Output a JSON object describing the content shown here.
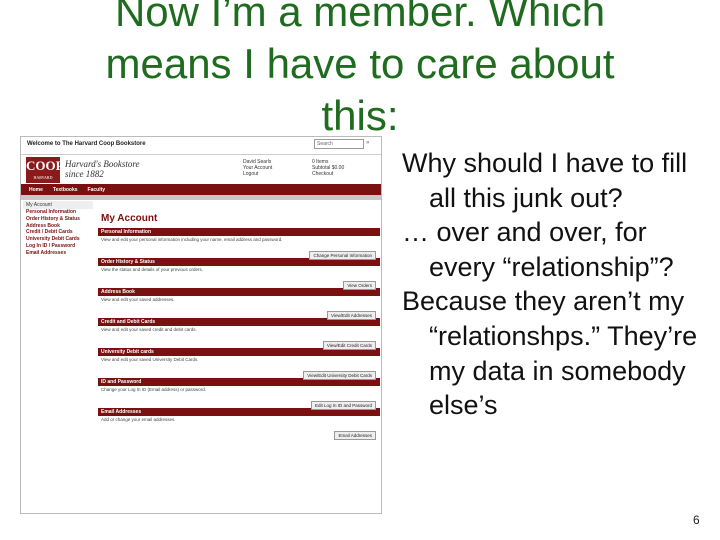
{
  "title": {
    "line1": "Now I’m a member. Which",
    "line2": "means I have to care about",
    "line3": "this:"
  },
  "bullets": [
    "Why should I have to fill all this junk out?",
    "… over and over, for every “relationship”?",
    "Because they aren’t my “relationshps.” They’re my data in somebody else’s"
  ],
  "page_number": "6",
  "screenshot": {
    "welcome": "Welcome to The Harvard Coop Bookstore",
    "search_placeholder": "Search",
    "logo_text": "COOP",
    "logo_sub": "HARVARD",
    "store_name_line1": "Harvard's Bookstore",
    "store_name_line2": "since 1882",
    "account_links": [
      "David Searls",
      "Your Account",
      "Logout"
    ],
    "cart_links": [
      "0 Items",
      "Subtotal $0.00",
      "Checkout"
    ],
    "nav": [
      "Home",
      "Textbooks",
      "Faculty"
    ],
    "sidebar_header": "My Account",
    "sidebar_links": [
      "Personal Information",
      "Order History & Status",
      "Address Book",
      "Credit / Debit Cards",
      "University Debit Cards",
      "Log In ID / Password",
      "Email Addresses"
    ],
    "main_title": "My Account",
    "sections": [
      {
        "title": "Personal Information",
        "desc": "View and edit your personal information including your name, email address and password.",
        "button": "Change Personal Information"
      },
      {
        "title": "Order History & Status",
        "desc": "View the status and details of your previous orders.",
        "button": "View Orders"
      },
      {
        "title": "Address Book",
        "desc": "View and edit your saved addresses.",
        "button": "View/Edit Addresses"
      },
      {
        "title": "Credit and Debit Cards",
        "desc": "View and edit your saved credit and debit cards.",
        "button": "View/Edit Credit Cards"
      },
      {
        "title": "University Debit cards",
        "desc": "View and edit your saved University Debit Cards.",
        "button": "View/Edit University Debit Cards"
      },
      {
        "title": "ID and Password",
        "desc": "Change your Log In ID (Email address) or password.",
        "button": "Edit Log In ID and Password"
      },
      {
        "title": "Email Addresses",
        "desc": "Add or change your email addresses.",
        "button": "Email Addresses"
      }
    ]
  }
}
